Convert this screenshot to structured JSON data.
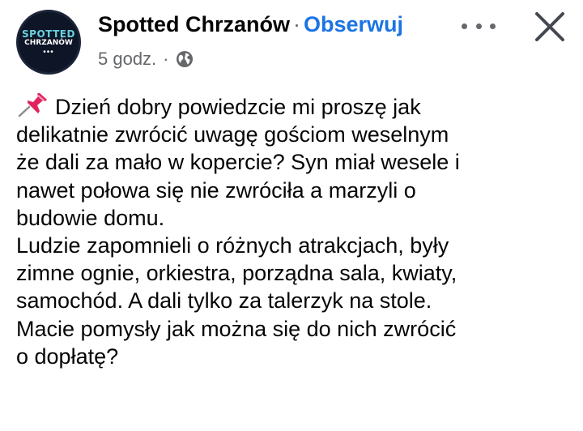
{
  "avatar": {
    "line1": "SPOTTED",
    "line2": "CHRZANÓW",
    "line3": "•••"
  },
  "header": {
    "page_name": "Spotted Chrzanów",
    "separator": "·",
    "follow_label": "Obserwuj"
  },
  "meta": {
    "time": "5 godz.",
    "separator": "·",
    "audience_icon": "globe-icon"
  },
  "icons": {
    "more": "more-options-icon",
    "close": "close-icon",
    "pin": "pushpin-icon"
  },
  "post": {
    "lines": [
      "Dzień dobry powiedzcie mi proszę jak",
      "delikatnie zwrócić uwagę gościom weselnym",
      "że dali za mało w kopercie? Syn miał wesele i",
      "nawet połowa się nie zwróciła a marzyli o",
      "budowie domu.",
      "Ludzie zapomnieli o różnych atrakcjach, były",
      "zimne ognie, orkiestra, porządna sala, kwiaty,",
      "samochód. A dali tylko za talerzyk na stole.",
      "Macie pomysły jak można się do nich zwrócić",
      "o dopłatę?"
    ]
  },
  "colors": {
    "link": "#1b74e4",
    "secondary_text": "#65676b",
    "primary_text": "#050505",
    "avatar_bg": "#0d1526",
    "avatar_accent": "#66d3de"
  }
}
